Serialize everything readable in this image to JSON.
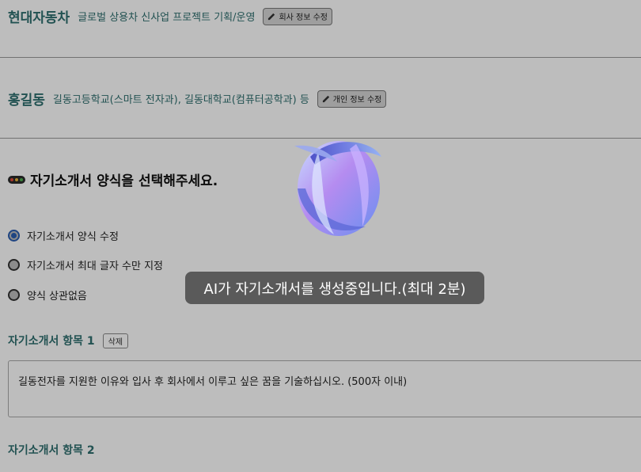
{
  "company": {
    "name": "현대자동차",
    "project": "글로벌 상용차 신사업 프로젝트 기획/운영",
    "edit_label": "회사 정보 수정"
  },
  "person": {
    "name": "홍길동",
    "education": "길동고등학교(스마트 전자과), 길동대학교(컴퓨터공학과) 등",
    "edit_label": "개인 정보 수정"
  },
  "prompt": {
    "text": "자기소개서 양식을 선택해주세요."
  },
  "options": [
    {
      "label": "자기소개서 양식 수정",
      "selected": true
    },
    {
      "label": "자기소개서 최대 글자 수만 지정",
      "selected": false
    },
    {
      "label": "양식 상관없음",
      "selected": false
    }
  ],
  "items": [
    {
      "title": "자기소개서 항목 1",
      "delete_label": "삭제",
      "question": "길동전자를 지원한 이유와 입사 후 회사에서 이루고 싶은 꿈을 기술하십시오. (500자 이내)"
    },
    {
      "title": "자기소개서 항목 2"
    }
  ],
  "loading": {
    "message": "AI가 자기소개서를 생성중입니다.(최대 2분)"
  },
  "colors": {
    "accent": "#2f6f6f",
    "radio": "#2a5db0",
    "toast": "#5a5a5a"
  },
  "icons": {
    "edit": "pencil-icon",
    "prompt": "traffic-light-icon",
    "loading": "ai-orb-icon"
  }
}
